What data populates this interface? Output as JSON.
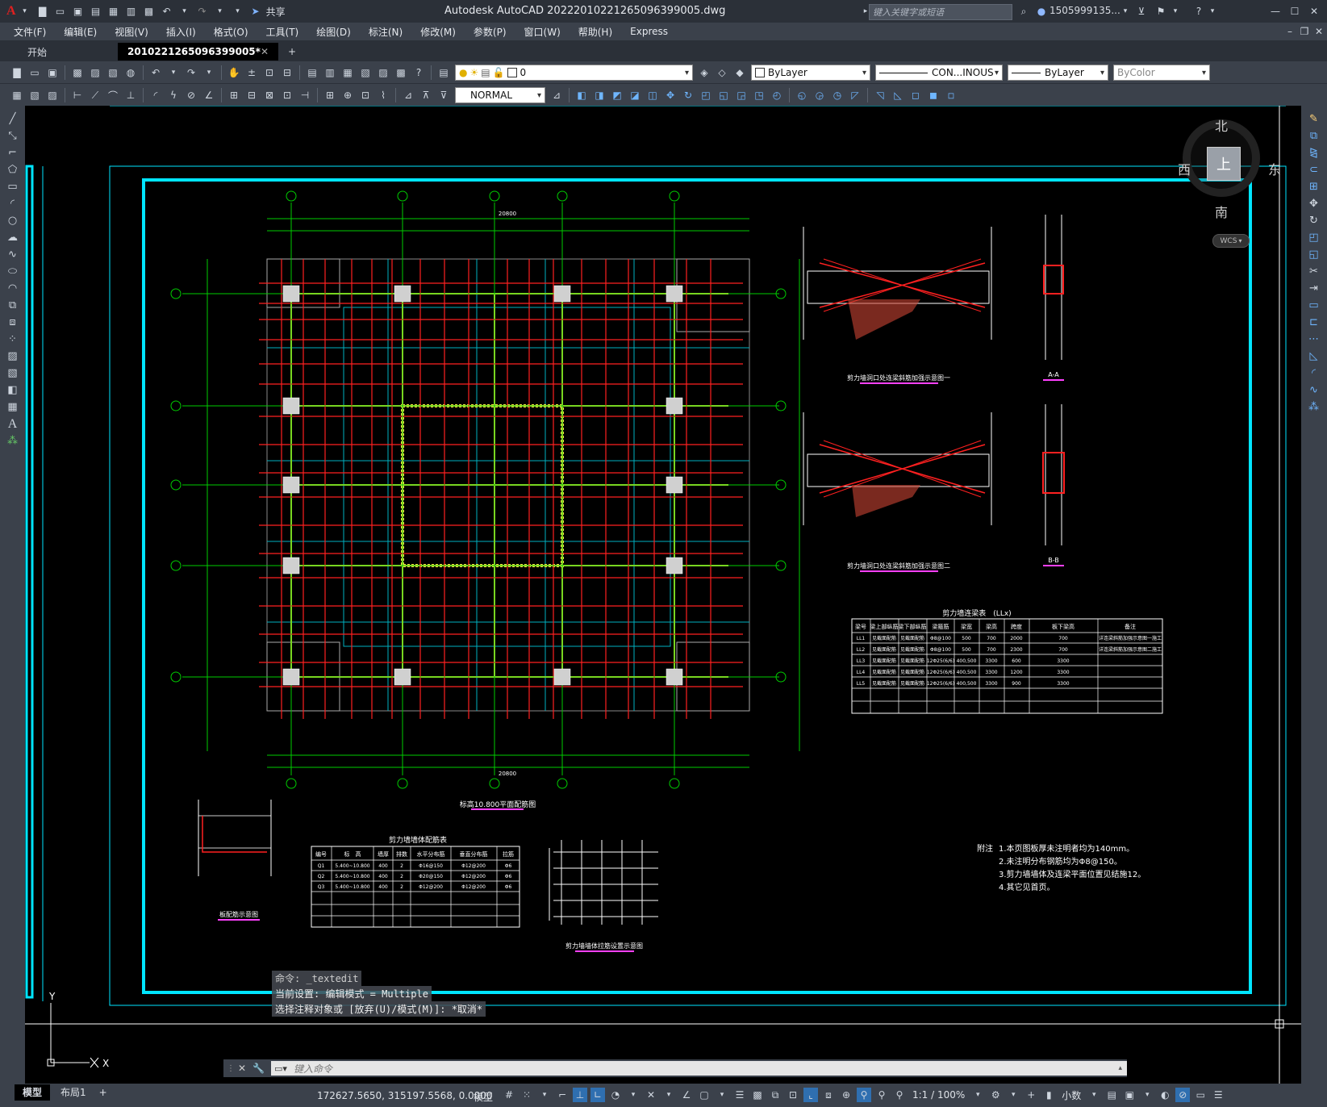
{
  "app_title": "Autodesk AutoCAD 2022",
  "file_name": "2010221265096399005.dwg",
  "search_placeholder": "键入关键字或短语",
  "user": "1505999135...",
  "share": "共享",
  "menu": [
    "文件(F)",
    "编辑(E)",
    "视图(V)",
    "插入(I)",
    "格式(O)",
    "工具(T)",
    "绘图(D)",
    "标注(N)",
    "修改(M)",
    "参数(P)",
    "窗口(W)",
    "帮助(H)",
    "Express"
  ],
  "tabs": {
    "start": "开始",
    "doc": "2010221265096399005*",
    "add": "+"
  },
  "toolbar": {
    "layer": "0",
    "color": "ByLayer",
    "linetype": "CON...INOUS",
    "lineweight": "ByLayer",
    "plotstyle": "ByColor",
    "dimstyle": "NORMAL"
  },
  "viewcube": {
    "north": "北",
    "south": "南",
    "west": "西",
    "east": "东",
    "top": "上",
    "wcs": "WCS"
  },
  "command_history": [
    "命令: _textedit",
    "当前设置: 编辑模式 = Multiple",
    "选择注释对象或 [放弃(U)/模式(M)]: *取消*"
  ],
  "command_placeholder": "键入命令",
  "ucs": {
    "y": "Y",
    "x": "X"
  },
  "layout_tabs": [
    "模型",
    "布局1",
    "+"
  ],
  "status": {
    "coords": "172627.5650, 315197.5568, 0.0000",
    "model": "模型",
    "scale": "1:1 / 100%",
    "units": "小数"
  },
  "drawing": {
    "plan_title": "标高10.800平面配筋图",
    "detail1_title": "剪力墙洞口处连梁斜筋加强示意图一",
    "detail2_title": "剪力墙洞口处连梁斜筋加强示意图二",
    "sectionA": "A-A",
    "sectionB": "B-B",
    "beam_table_title": "剪力墙连梁表　(LLx)",
    "beam_table_headers": [
      "梁号",
      "梁上部纵筋",
      "梁下部纵筋",
      "梁箍筋",
      "梁宽",
      "梁高",
      "跨度",
      "板下梁高",
      "备注"
    ],
    "beam_table_rows": [
      [
        "LL1",
        "见截面配筋",
        "见截面配筋",
        "Φ8@100",
        "500",
        "700",
        "2000",
        "700",
        "详连梁斜筋加强示意图一施工"
      ],
      [
        "LL2",
        "见截面配筋",
        "见截面配筋",
        "Φ8@100",
        "500",
        "700",
        "2300",
        "700",
        "详连梁斜筋加强示意图二施工"
      ],
      [
        "LL3",
        "见截面配筋",
        "见截面配筋",
        "12Φ25(6/6)",
        "400,500",
        "3300",
        "600",
        "3300",
        ""
      ],
      [
        "LL4",
        "见截面配筋",
        "见截面配筋",
        "12Φ25(6/6)",
        "400,500",
        "3300",
        "1200",
        "3300",
        ""
      ],
      [
        "LL5",
        "见截面配筋",
        "见截面配筋",
        "12Φ25(6/6)",
        "400,500",
        "3300",
        "900",
        "3300",
        ""
      ]
    ],
    "wall_table_title": "剪力墙墙体配筋表",
    "wall_table_headers": [
      "编号",
      "标　高",
      "墙厚",
      "排数",
      "水平分布筋",
      "垂直分布筋",
      "拉筋"
    ],
    "wall_table_rows": [
      [
        "Q1",
        "5.400~10.800",
        "400",
        "2",
        "Φ16@150",
        "Φ12@200",
        "Φ6"
      ],
      [
        "Q2",
        "5.400~10.800",
        "400",
        "2",
        "Φ20@150",
        "Φ12@200",
        "Φ6"
      ],
      [
        "Q3",
        "5.400~10.800",
        "400",
        "2",
        "Φ12@200",
        "Φ12@200",
        "Φ6"
      ]
    ],
    "plate_detail_title": "板配筋示意图",
    "tie_detail_title": "剪力墙墙体拉筋设置示意图",
    "notes_label": "附注",
    "notes": [
      "1.本页图板厚未注明者均为140mm。",
      "2.未注明分布钢筋均为Φ8@150。",
      "3.剪力墙墙体及连梁平面位置见结施12。",
      "4.其它见首页。"
    ],
    "dim_total": "20800"
  },
  "colors": {
    "frame": "#00e5ff",
    "axis": "#00cc00",
    "rebar": "#ff2020",
    "beam": "#f0e040",
    "wall": "#00b0c0",
    "text_white": "#ffffff"
  }
}
